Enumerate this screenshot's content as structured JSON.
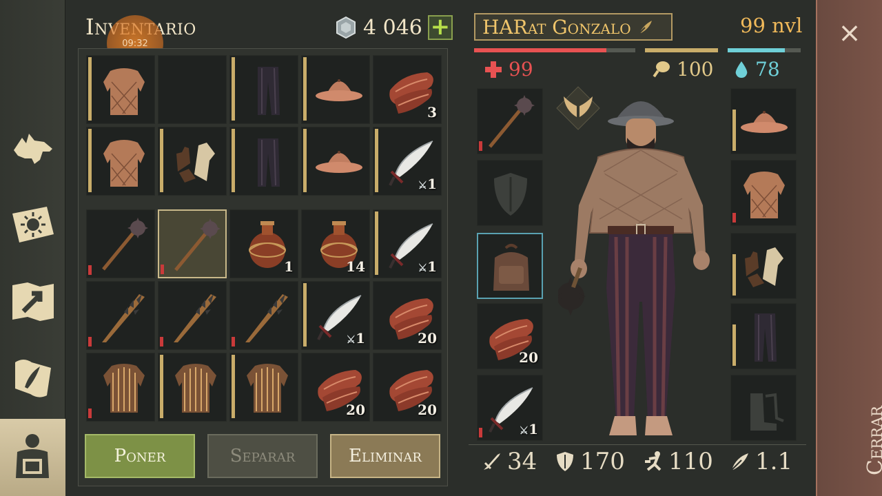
{
  "inventory": {
    "title": "Inventario",
    "coins": "4 046",
    "add_coins": "+",
    "clock": "09:32"
  },
  "slots_top": [
    {
      "icon": "gambeson-icon",
      "qty": "",
      "dur": "full"
    },
    {
      "icon": "",
      "qty": "",
      "dur": ""
    },
    {
      "icon": "dark-trousers-icon",
      "qty": "",
      "dur": "full"
    },
    {
      "icon": "kettle-hat-icon",
      "qty": "",
      "dur": "full"
    },
    {
      "icon": "raw-meat-icon",
      "qty": "3",
      "dur": ""
    },
    {
      "icon": "gambeson-icon",
      "qty": "",
      "dur": "full"
    },
    {
      "icon": "leather-gloves-icon",
      "qty": "",
      "dur": "full"
    },
    {
      "icon": "dark-trousers-icon",
      "qty": "",
      "dur": "full"
    },
    {
      "icon": "kettle-hat-icon",
      "qty": "",
      "dur": "full"
    },
    {
      "icon": "scimitar-icon",
      "qty": "1",
      "dur": "full"
    }
  ],
  "slots_bottom": [
    {
      "icon": "flail-mace-icon",
      "qty": "",
      "dur": "low"
    },
    {
      "icon": "flail-mace-icon",
      "qty": "",
      "dur": "low"
    },
    {
      "icon": "water-flask-icon",
      "qty": "1",
      "dur": ""
    },
    {
      "icon": "water-flask-icon",
      "qty": "14",
      "dur": ""
    },
    {
      "icon": "scimitar-icon",
      "qty": "1",
      "dur": "full"
    },
    {
      "icon": "spiked-club-icon",
      "qty": "",
      "dur": "low"
    },
    {
      "icon": "spiked-club-icon",
      "qty": "",
      "dur": "low"
    },
    {
      "icon": "spiked-club-icon",
      "qty": "",
      "dur": "low"
    },
    {
      "icon": "scimitar-icon",
      "qty": "1",
      "dur": "full"
    },
    {
      "icon": "raw-meat-icon",
      "qty": "20",
      "dur": ""
    },
    {
      "icon": "mail-shirt-icon",
      "qty": "",
      "dur": "low"
    },
    {
      "icon": "mail-shirt-icon",
      "qty": "",
      "dur": "full"
    },
    {
      "icon": "mail-shirt-icon",
      "qty": "",
      "dur": "full"
    },
    {
      "icon": "raw-meat-icon",
      "qty": "20",
      "dur": ""
    },
    {
      "icon": "raw-meat-icon",
      "qty": "20",
      "dur": ""
    }
  ],
  "actions": {
    "poner": "Poner",
    "separar": "Separar",
    "eliminar": "Eliminar"
  },
  "character": {
    "name": "HARat Gonzalo",
    "level": "99 nvl",
    "health": "99",
    "food": "100",
    "water": "78",
    "health_fraction": 0.82,
    "food_fraction": 1.0,
    "water_fraction": 0.78
  },
  "equipment_left": [
    {
      "icon": "flail-mace-icon",
      "qty": "",
      "dur": "low"
    },
    {
      "icon": "shield-slot-icon",
      "qty": "",
      "dur": ""
    },
    {
      "icon": "backpack-icon",
      "qty": "",
      "dur": ""
    },
    {
      "icon": "raw-meat-icon",
      "qty": "20",
      "dur": ""
    },
    {
      "icon": "scimitar-icon",
      "qty": "1",
      "dur": "low"
    }
  ],
  "equipment_right": [
    {
      "icon": "kettle-hat-icon",
      "qty": "",
      "dur": "full"
    },
    {
      "icon": "gambeson-icon",
      "qty": "",
      "dur": "low"
    },
    {
      "icon": "leather-gloves-icon",
      "qty": "",
      "dur": "full"
    },
    {
      "icon": "dark-trousers-icon",
      "qty": "",
      "dur": "full"
    },
    {
      "icon": "boots-slot-icon",
      "qty": "",
      "dur": ""
    }
  ],
  "stats": {
    "attack": "34",
    "armor": "170",
    "speed": "110",
    "weight": "1.1"
  },
  "close": {
    "label": "Cerrar",
    "x": "×"
  },
  "colors": {
    "health": "#e85252",
    "food": "#c9ad6a",
    "water": "#6fd0d8",
    "accent_gold": "#f0c56b",
    "close_panel": "#7a5448"
  }
}
